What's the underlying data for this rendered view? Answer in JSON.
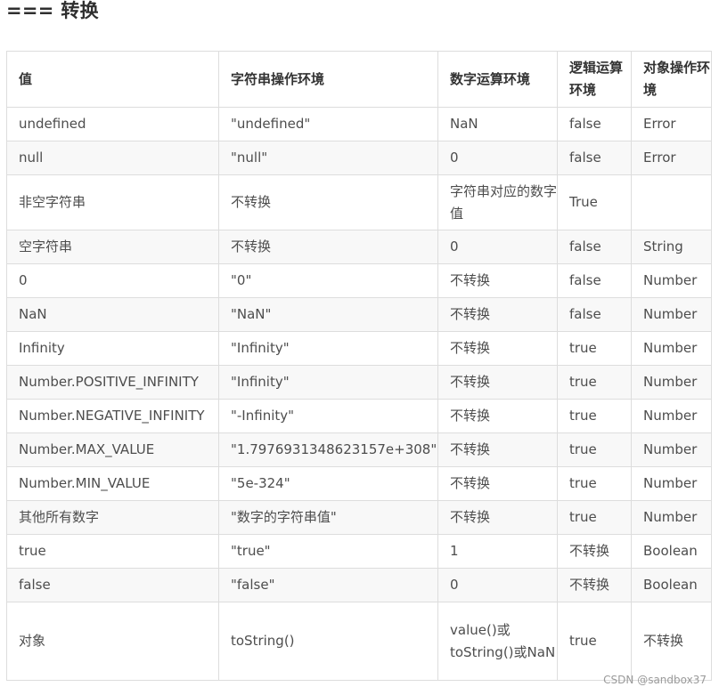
{
  "heading": "=== 转换",
  "table": {
    "headers": [
      "值",
      "字符串操作环境",
      "数字运算环境",
      "逻辑运算环境",
      "对象操作环境"
    ],
    "rows": [
      [
        "undefined",
        "\"undefined\"",
        "NaN",
        "false",
        "Error"
      ],
      [
        "null",
        "\"null\"",
        "0",
        "false",
        "Error"
      ],
      [
        "非空字符串",
        "不转换",
        "字符串对应的数字值",
        "True",
        ""
      ],
      [
        "空字符串",
        "不转换",
        "0",
        "false",
        "String"
      ],
      [
        "0",
        "\"0\"",
        "不转换",
        "false",
        "Number"
      ],
      [
        "NaN",
        "\"NaN\"",
        "不转换",
        "false",
        "Number"
      ],
      [
        "Infinity",
        "\"Infinity\"",
        "不转换",
        "true",
        "Number"
      ],
      [
        "Number.POSITIVE_INFINITY",
        "\"Infinity\"",
        "不转换",
        "true",
        "Number"
      ],
      [
        "Number.NEGATIVE_INFINITY",
        "\"-Infinity\"",
        "不转换",
        "true",
        "Number"
      ],
      [
        "Number.MAX_VALUE",
        "\"1.7976931348623157e+308\"",
        "不转换",
        "true",
        "Number"
      ],
      [
        "Number.MIN_VALUE",
        "\"5e-324\"",
        "不转换",
        "true",
        "Number"
      ],
      [
        "其他所有数字",
        "\"数字的字符串值\"",
        "不转换",
        "true",
        "Number"
      ],
      [
        "true",
        "\"true\"",
        "1",
        "不转换",
        "Boolean"
      ],
      [
        "false",
        "\"false\"",
        "0",
        "不转换",
        "Boolean"
      ],
      [
        "对象",
        "toString()",
        "value()或toString()或NaN",
        "true",
        "不转换"
      ]
    ]
  },
  "watermark": "CSDN @sandbox37"
}
